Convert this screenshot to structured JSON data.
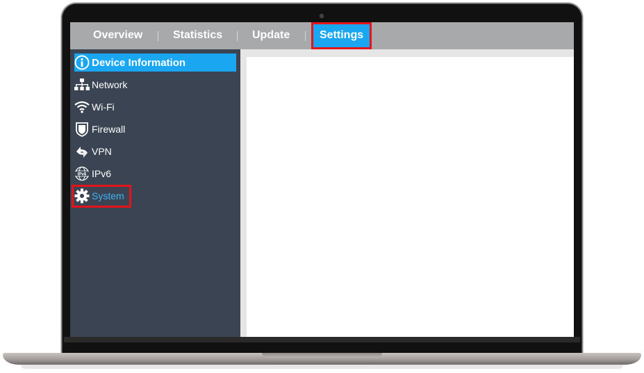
{
  "nav": {
    "tabs": [
      {
        "label": "Overview"
      },
      {
        "label": "Statistics"
      },
      {
        "label": "Update"
      },
      {
        "label": "Settings"
      }
    ],
    "active_tab": "Settings"
  },
  "sidebar": {
    "items": [
      {
        "label": "Device Information",
        "icon": "info-icon"
      },
      {
        "label": "Network",
        "icon": "network-icon"
      },
      {
        "label": "Wi-Fi",
        "icon": "wifi-icon"
      },
      {
        "label": "Firewall",
        "icon": "shield-icon"
      },
      {
        "label": "VPN",
        "icon": "vpn-icon"
      },
      {
        "label": "IPv6",
        "icon": "ipv6-icon"
      },
      {
        "label": "System",
        "icon": "gear-icon"
      }
    ],
    "selected_item": "Device Information",
    "highlighted_item": "System"
  },
  "colors": {
    "accent": "#1aa6f0",
    "sidebar_bg": "#3a4452",
    "topbar_bg": "#a8a9ab",
    "annotation": "#e4141b"
  }
}
